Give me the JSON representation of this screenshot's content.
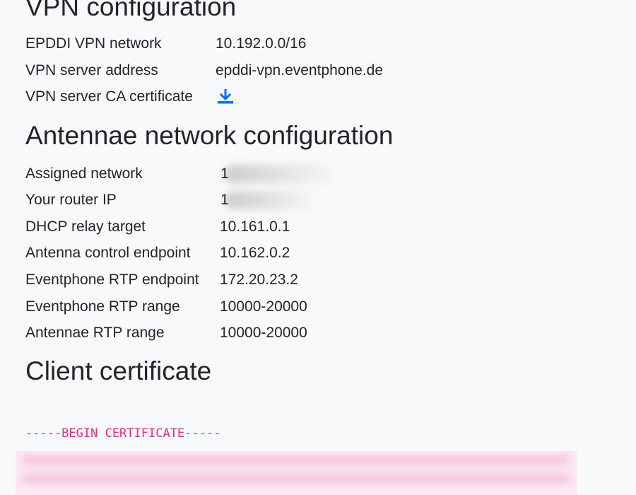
{
  "vpn": {
    "heading": "VPN configuration",
    "rows": [
      {
        "label": "EPDDI VPN network",
        "value": "10.192.0.0/16"
      },
      {
        "label": "VPN server address",
        "value": "epddi-vpn.eventphone.de"
      },
      {
        "label": "VPN server CA certificate",
        "value": ""
      }
    ],
    "download_icon": "download-arrow-icon",
    "accent_color": "#0d6efd"
  },
  "antennae": {
    "heading": "Antennae network configuration",
    "rows": [
      {
        "label": "Assigned network",
        "value": "1"
      },
      {
        "label": "Your router IP",
        "value": "1"
      },
      {
        "label": "DHCP relay target",
        "value": "10.161.0.1"
      },
      {
        "label": "Antenna control endpoint",
        "value": "10.162.0.2"
      },
      {
        "label": "Eventphone RTP endpoint",
        "value": "172.20.23.2"
      },
      {
        "label": "Eventphone RTP range",
        "value": "10000-20000"
      },
      {
        "label": "Antennae RTP range",
        "value": "10000-20000"
      }
    ]
  },
  "client_certificate": {
    "heading": "Client certificate",
    "begin_marker": "-----BEGIN CERTIFICATE-----",
    "code_color": "#d63384"
  }
}
